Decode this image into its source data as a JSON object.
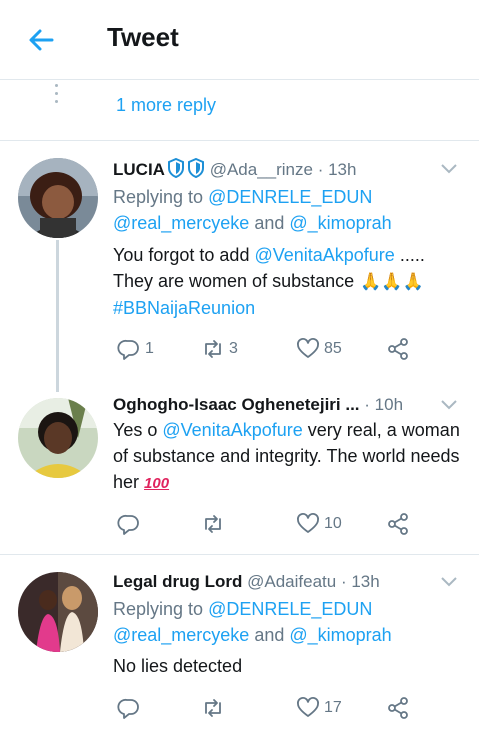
{
  "header": {
    "title": "Tweet",
    "back_icon": "back-arrow-icon"
  },
  "more_reply": "1 more reply",
  "tweets": [
    {
      "name": "LUCIA",
      "handle": "@Ada__rinze",
      "time": "· 13h",
      "replying_prefix": "Replying to ",
      "replying_to_1": "@DENRELE_EDUN",
      "replying_to_2": "@real_mercyeke",
      "replying_and": " and ",
      "replying_to_3": "@_kimoprah",
      "text_1": "You forgot to add ",
      "mention": "@VenitaAkpofure",
      "text_2": " .....",
      "text_3": "They are women of substance ",
      "hashtag": "#BBNaijaReunion",
      "replies": "1",
      "retweets": "3",
      "likes": "85"
    },
    {
      "name": "Oghogho-Isaac Oghenetejiri ...",
      "handle": "",
      "time": "· 10h",
      "text_1": "Yes o ",
      "mention": "@VenitaAkpofure",
      "text_2": " very real, a woman of  substance and integrity. The world needs her ",
      "replies": "",
      "retweets": "",
      "likes": "10"
    },
    {
      "name": "Legal drug Lord",
      "handle": "@Adaifeatu",
      "time": "· 13h",
      "replying_prefix": "Replying to ",
      "replying_to_1": "@DENRELE_EDUN",
      "replying_to_2": "@real_mercyeke",
      "replying_and": " and ",
      "replying_to_3": "@_kimoprah",
      "text_1": "No lies detected",
      "replies": "",
      "retweets": "",
      "likes": "17"
    }
  ],
  "colors": {
    "accent": "#1da1f2",
    "muted": "#657786",
    "divider": "#e1e8ed"
  }
}
